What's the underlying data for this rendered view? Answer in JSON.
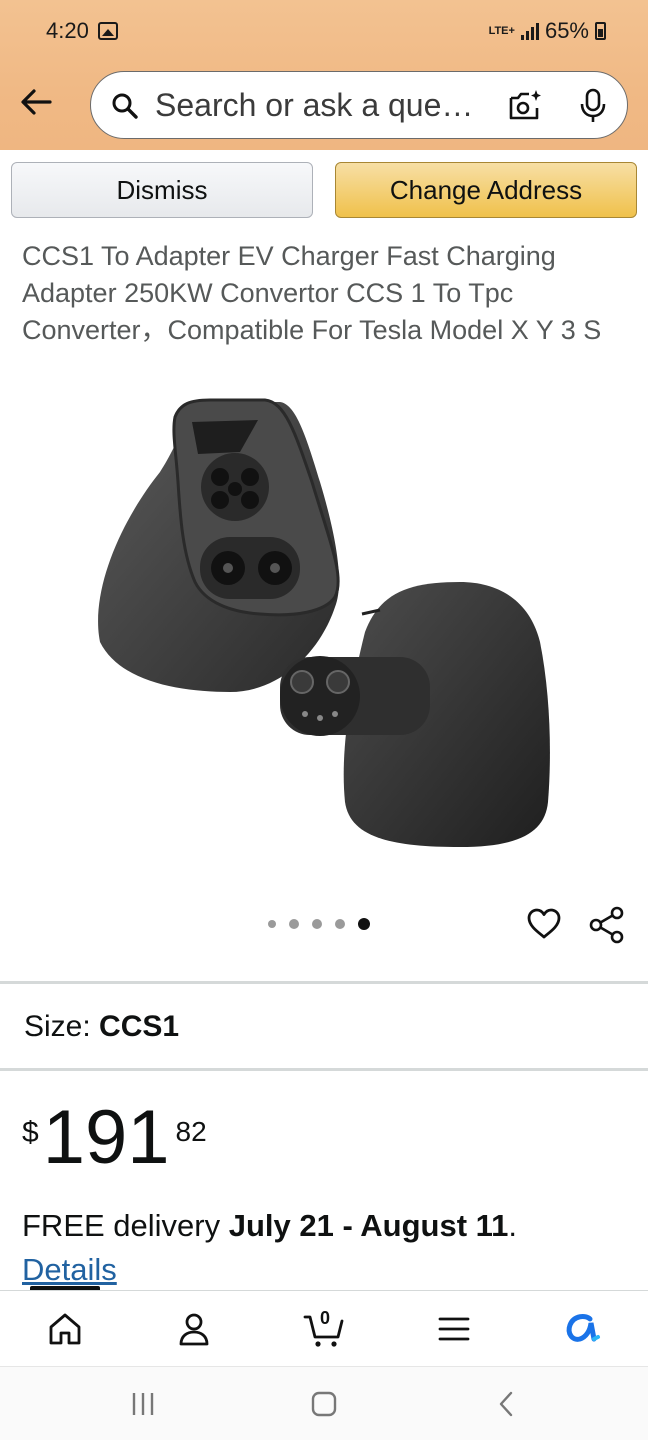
{
  "status": {
    "time": "4:20",
    "network": "LTE+",
    "battery": "65%"
  },
  "search": {
    "placeholder": "Search or ask a que…"
  },
  "buttons": {
    "dismiss": "Dismiss",
    "change_address": "Change Address"
  },
  "product": {
    "title": "CCS1 To Adapter EV Charger Fast Charging Adapter 250KW Convertor CCS 1 To Tpc Converter，Compatible For Tesla Model X Y 3 S",
    "image_dots": {
      "count": 5,
      "active_index": 4
    },
    "size_label": "Size:",
    "size_value": "CCS1",
    "price": {
      "symbol": "$",
      "whole": "191",
      "fraction": "82"
    },
    "delivery_prefix": "FREE delivery ",
    "delivery_dates": "July 21 - August 11",
    "delivery_suffix": ".",
    "details_link": "Details"
  },
  "tabbar": {
    "cart_count": "0",
    "items": [
      "home-icon",
      "account-icon",
      "cart-icon",
      "menu-icon",
      "rufus-icon"
    ]
  },
  "colors": {
    "header": "#f0b985",
    "accent_button": "#f0c14b",
    "link": "#2162a1"
  }
}
